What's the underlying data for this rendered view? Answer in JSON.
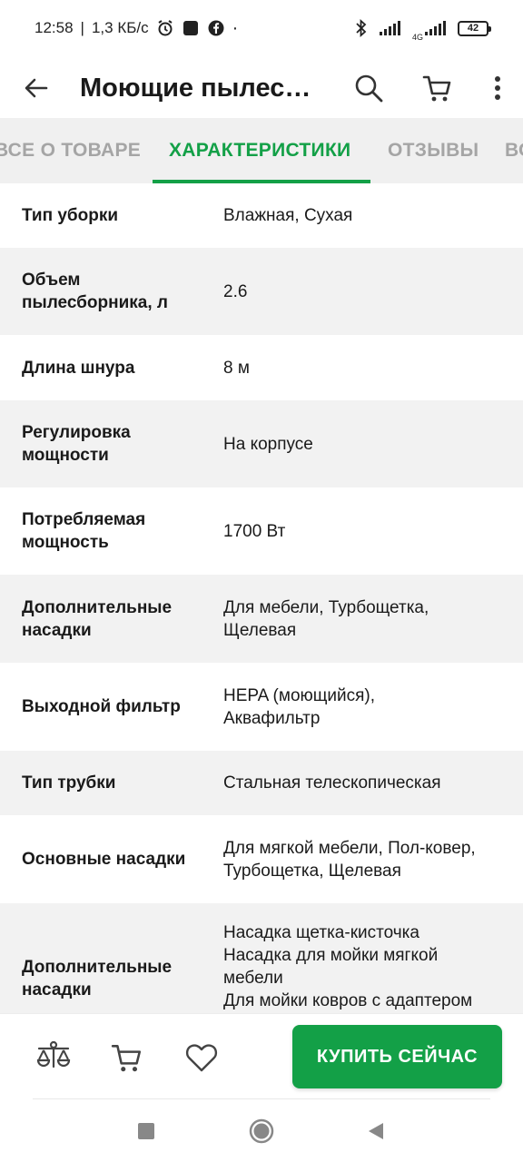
{
  "status": {
    "time": "12:58",
    "separator": "|",
    "speed": "1,3 КБ/с",
    "network_label": "4G",
    "battery": "42"
  },
  "appbar": {
    "title": "Моющие пылес…"
  },
  "tabs": [
    {
      "label": "ВСЕ О ТОВАРЕ",
      "active": false
    },
    {
      "label": "ХАРАКТЕРИСТИКИ",
      "active": true
    },
    {
      "label": "ОТЗЫВЫ",
      "active": false
    },
    {
      "label": "ВО",
      "active": false
    }
  ],
  "specs": [
    {
      "key": "Тип уборки",
      "value": "Влажная, Сухая"
    },
    {
      "key": "Объем\nпылесборника, л",
      "value": "2.6"
    },
    {
      "key": "Длина шнура",
      "value": "8 м"
    },
    {
      "key": "Регулировка\nмощности",
      "value": "На корпусе"
    },
    {
      "key": "Потребляемая\nмощность",
      "value": "1700 Вт"
    },
    {
      "key": "Дополнительные\nнасадки",
      "value": "Для мебели, Турбощетка,\nЩелевая"
    },
    {
      "key": "Выходной фильтр",
      "value": "HEPA (моющийся),\nАквафильтр"
    },
    {
      "key": "Тип трубки",
      "value": "Стальная телескопическая"
    },
    {
      "key": "Основные насадки",
      "value": "Для мягкой мебели, Пол-ковер,\nТурбощетка, Щелевая"
    },
    {
      "key": "Дополнительные\nнасадки",
      "value": "Насадка щетка-кисточка\nНасадка для мойки мягкой\nмебели\nДля мойки ковров с адаптером"
    }
  ],
  "bottombar": {
    "buy_label": "КУПИТЬ СЕЙЧАС"
  },
  "colors": {
    "accent": "#13a047",
    "tab_bg": "#f0f0f0",
    "row_alt": "#f2f2f2"
  },
  "icons": [
    "back-arrow-icon",
    "search-icon",
    "cart-icon",
    "more-vert-icon",
    "compare-scales-icon",
    "add-to-cart-icon",
    "favorite-heart-icon",
    "alarm-icon",
    "bluetooth-icon",
    "signal-icon",
    "battery-icon"
  ]
}
